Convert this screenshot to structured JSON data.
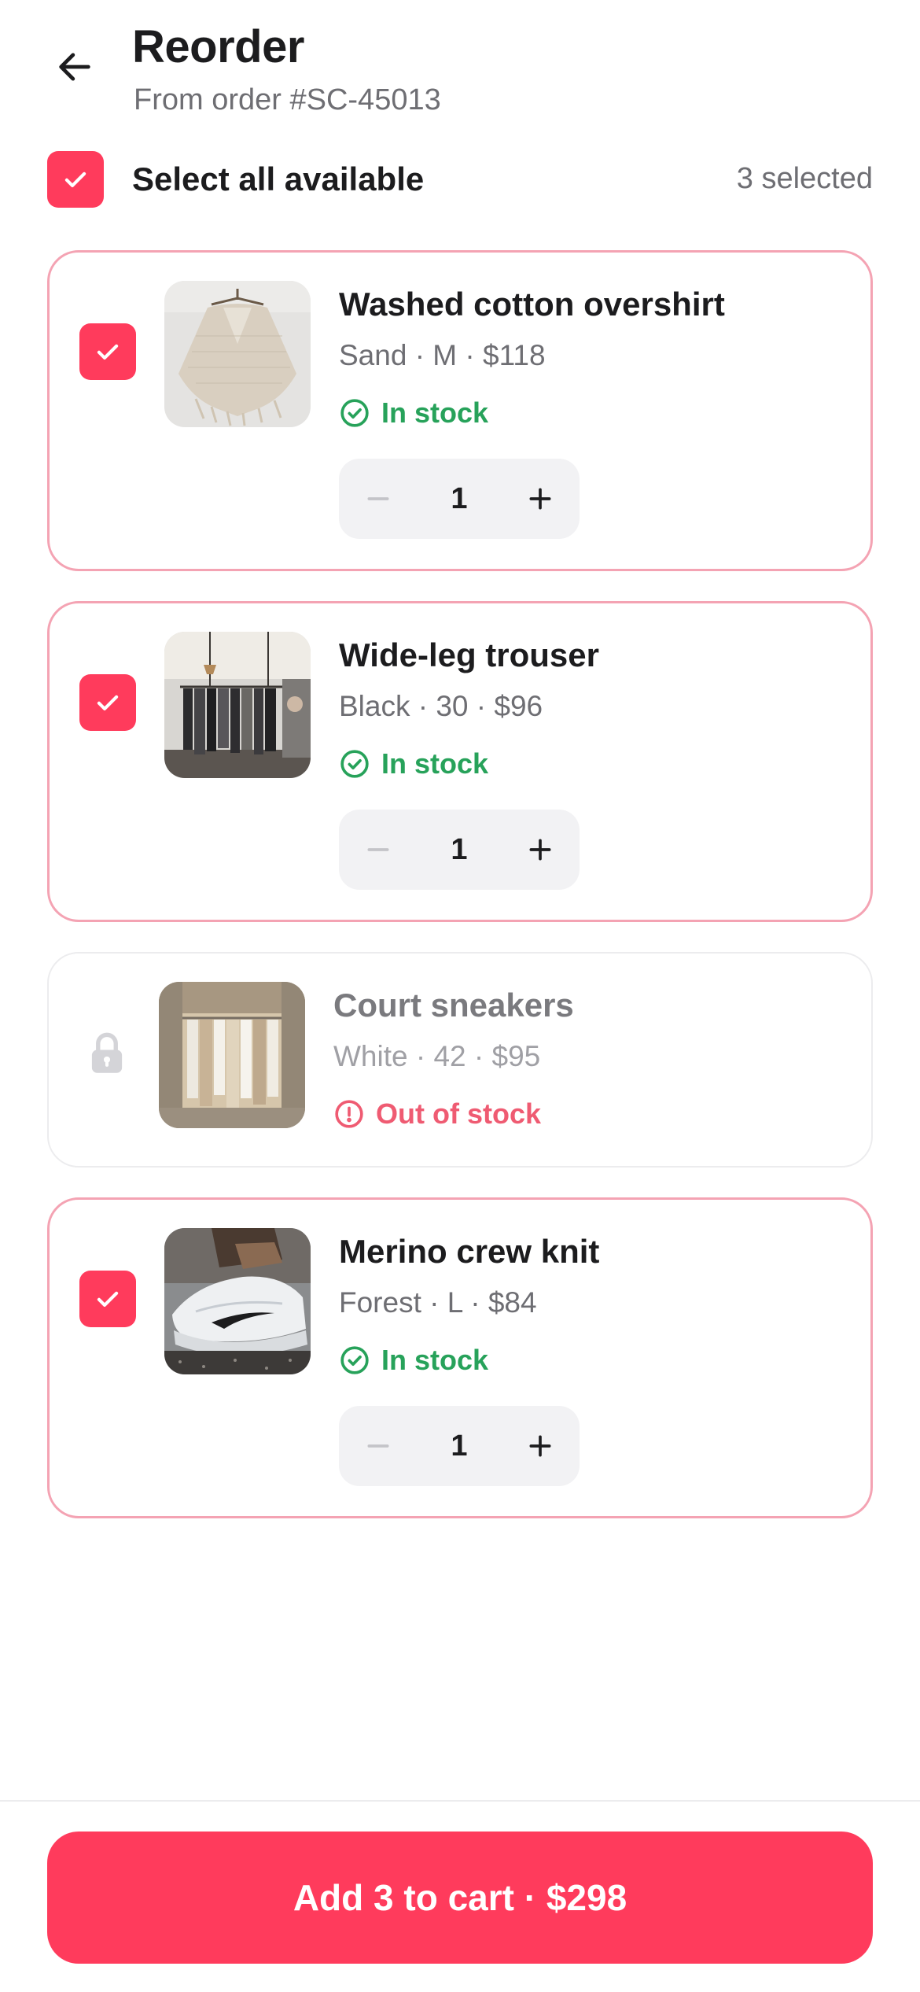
{
  "header": {
    "title": "Reorder",
    "subtitle": "From order #SC-45013"
  },
  "select_all": {
    "label": "Select all available",
    "count_text": "3 selected",
    "checked": true
  },
  "items": [
    {
      "name": "Washed cotton overshirt",
      "meta": "Sand · M · $118",
      "status": "In stock",
      "quantity": "1",
      "checked": true,
      "available": true,
      "thumb_icon": "sweater-photo"
    },
    {
      "name": "Wide-leg trouser",
      "meta": "Black · 30 · $96",
      "status": "In stock",
      "quantity": "1",
      "checked": true,
      "available": true,
      "thumb_icon": "clothing-store-photo"
    },
    {
      "name": "Court sneakers",
      "meta": "White · 42 · $95",
      "status": "Out of stock",
      "available": false,
      "thumb_icon": "clothing-rack-photo"
    },
    {
      "name": "Merino crew knit",
      "meta": "Forest · L · $84",
      "status": "In stock",
      "quantity": "1",
      "checked": true,
      "available": true,
      "thumb_icon": "sneaker-photo"
    }
  ],
  "cta": {
    "label": "Add 3 to cart · $298"
  },
  "colors": {
    "accent": "#ff3b5c",
    "in_stock": "#27a25a",
    "out_of_stock": "#ef5b72",
    "card_border": "#f4a3b3"
  }
}
